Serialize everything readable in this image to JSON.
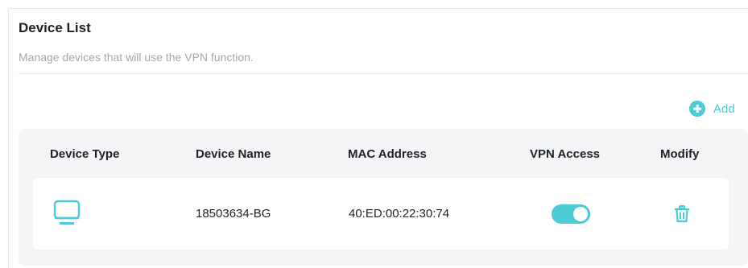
{
  "header": {
    "title": "Device List",
    "subtitle": "Manage devices that will use the VPN function."
  },
  "toolbar": {
    "add_label": "Add",
    "add_icon": "plus-circle-icon"
  },
  "table": {
    "columns": [
      "Device Type",
      "Device Name",
      "MAC Address",
      "VPN Access",
      "Modify"
    ],
    "rows": [
      {
        "device_type_icon": "monitor-icon",
        "device_name": "18503634-BG",
        "mac_address": "40:ED:00:22:30:74",
        "vpn_access": true,
        "modify_icon": "trash-icon"
      }
    ]
  },
  "colors": {
    "accent": "#4acbd6",
    "text": "#1f2226",
    "muted": "#a3a8b0",
    "table_bg": "#f4f5f7"
  }
}
